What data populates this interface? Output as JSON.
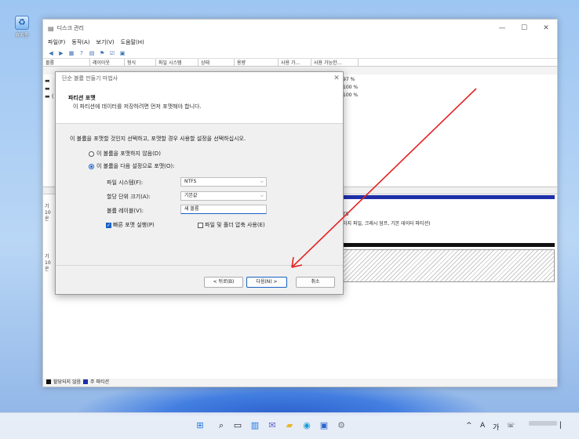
{
  "desktop": {
    "recycle_bin_label": "휴지통"
  },
  "window": {
    "title": "디스크 관리",
    "controls": {
      "minimize": "—",
      "maximize": "☐",
      "close": "✕"
    },
    "menu": [
      "파일(F)",
      "동작(A)",
      "보기(V)",
      "도움말(H)"
    ],
    "columns": [
      "볼륨",
      "레이아웃",
      "형식",
      "파일 시스템",
      "상태",
      "용량",
      "사용 가...",
      "사용 가능한..."
    ],
    "volume_rows": [
      {
        "name": "",
        "pct": "97 %"
      },
      {
        "name": "",
        "pct": "100 %"
      },
      {
        "name": "(",
        "pct": "100 %"
      }
    ],
    "disks": [
      {
        "label_lines": [
          "기",
          "10",
          "온"
        ],
        "partition_text_1": "TS",
        "partition_text_2": "이지 파일, 크래시 덤프, 기본 데이터 파티션)"
      },
      {
        "label_lines": [
          "기",
          "10",
          "온"
        ]
      }
    ],
    "legend": [
      {
        "text": "할당되지 않음",
        "color": "#111111"
      },
      {
        "text": "주 파티션",
        "color": "#1f2fa8"
      }
    ]
  },
  "wizard": {
    "title": "단순 볼륨 만들기 마법사",
    "close": "✕",
    "heading": "파티션 포맷",
    "subheading": "이 파티션에 데이터를 저장하려면 먼저 포맷해야 합니다.",
    "instruction": "이 볼륨을 포맷할 것인지 선택하고, 포맷할 경우 사용할 설정을 선택하십시오.",
    "radio_no_format": "이 볼륨을 포맷하지 않음(D)",
    "radio_format": "이 볼륨을 다음 설정으로 포맷(O):",
    "fields": {
      "filesystem_label": "파일 시스템(F):",
      "filesystem_value": "NTFS",
      "alloc_label": "할당 단위 크기(A):",
      "alloc_value": "기본값",
      "volume_label_label": "볼륨 레이블(V):",
      "volume_label_value": "새 볼륨"
    },
    "quick_format": "빠른 포맷 실행(P)",
    "compression": "파일 및 폴더 압축 사용(E)",
    "buttons": {
      "back": "< 뒤로(B)",
      "next": "다음(N) >",
      "cancel": "취소"
    },
    "chevron": "⌵"
  },
  "taskbar": {
    "tray": {
      "chevron": "^",
      "ime": "A",
      "ime2": "가"
    }
  },
  "colors": {
    "accent": "#1862c4",
    "arrow": "#e52222",
    "partition": "#1f2fa8"
  }
}
